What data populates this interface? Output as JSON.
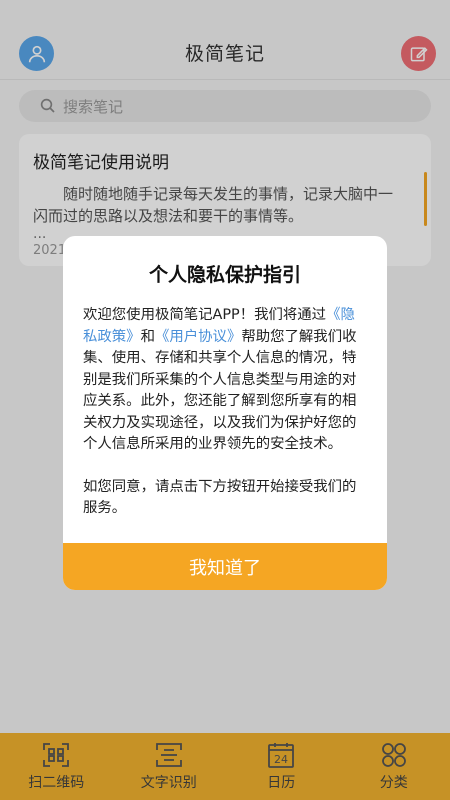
{
  "header": {
    "title": "极简笔记"
  },
  "search": {
    "placeholder": "搜索笔记"
  },
  "notes": [
    {
      "title": "极简笔记使用说明",
      "preview": "随时随地随手记录每天发生的事情，记录大脑中一闪而过的思路以及想法和要干的事情等。",
      "ellipsis": "...",
      "date": "2021"
    }
  ],
  "dialog": {
    "title": "个人隐私保护指引",
    "text_1": "欢迎您使用极简笔记APP！我们将通过",
    "privacy_link": "《隐私政策》",
    "text_and": "和",
    "agreement_link": "《用户协议》",
    "text_2": "帮助您了解我们收集、使用、存储和共享个人信息的情况，特别是我们所采集的个人信息类型与用途的对应关系。此外，您还能了解到您所享有的相关权力及实现途径，以及我们为保护好您的个人信息所采用的业界领先的安全技术。",
    "text_3": "如您同意，请点击下方按钮开始接受我们的服务。",
    "confirm_label": "我知道了"
  },
  "tabs": [
    {
      "label": "扫二维码",
      "icon": "qr-scan-icon"
    },
    {
      "label": "文字识别",
      "icon": "text-scan-icon"
    },
    {
      "label": "日历",
      "icon": "calendar-icon",
      "day": "24"
    },
    {
      "label": "分类",
      "icon": "category-icon"
    }
  ],
  "colors": {
    "accent": "#f5a623",
    "tabbar": "#f2b32f",
    "avatar": "#5aa6ea",
    "edit": "#ef6e74",
    "link": "#4a90d9"
  }
}
